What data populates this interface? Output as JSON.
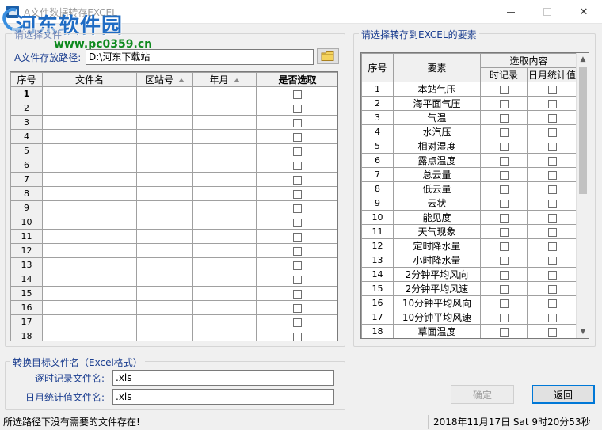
{
  "window": {
    "title": "A文件数据转存EXCEL"
  },
  "watermark": {
    "text": "河东软件园",
    "url": "www.pc0359.cn"
  },
  "select_file_group": {
    "legend": "请选择文件",
    "path_label": "A文件存放路径:",
    "path_value": "D:\\河东下载站",
    "columns": [
      "序号",
      "文件名",
      "区站号",
      "年月",
      "是否选取"
    ],
    "rows": [
      "1",
      "2",
      "3",
      "4",
      "5",
      "6",
      "7",
      "8",
      "9",
      "10",
      "11",
      "12",
      "13",
      "14",
      "15",
      "16",
      "17",
      "18"
    ]
  },
  "elements_group": {
    "legend": "请选择转存到EXCEL的要素",
    "header_no": "序号",
    "header_element": "要素",
    "header_select": "选取内容",
    "header_record": "时记录",
    "header_daily": "日月统计值",
    "rows": [
      {
        "no": "1",
        "name": "本站气压"
      },
      {
        "no": "2",
        "name": "海平面气压"
      },
      {
        "no": "3",
        "name": "气温"
      },
      {
        "no": "4",
        "name": "水汽压"
      },
      {
        "no": "5",
        "name": "相对湿度"
      },
      {
        "no": "6",
        "name": "露点温度"
      },
      {
        "no": "7",
        "name": "总云量"
      },
      {
        "no": "8",
        "name": "低云量"
      },
      {
        "no": "9",
        "name": "云状"
      },
      {
        "no": "10",
        "name": "能见度"
      },
      {
        "no": "11",
        "name": "天气现象"
      },
      {
        "no": "12",
        "name": "定时降水量"
      },
      {
        "no": "13",
        "name": "小时降水量"
      },
      {
        "no": "14",
        "name": "2分钟平均风向"
      },
      {
        "no": "15",
        "name": "2分钟平均风速"
      },
      {
        "no": "16",
        "name": "10分钟平均风向"
      },
      {
        "no": "17",
        "name": "10分钟平均风速"
      },
      {
        "no": "18",
        "name": "草面温度"
      }
    ]
  },
  "target_group": {
    "legend": "转换目标文件名（Excel格式）",
    "record_label": "逐时记录文件名:",
    "record_value": ".xls",
    "daily_label": "日月统计值文件名:",
    "daily_value": ".xls"
  },
  "buttons": {
    "confirm": "确定",
    "back": "返回"
  },
  "status": {
    "message": "所选路径下没有需要的文件存在!",
    "datetime": "2018年11月17日  Sat 9时20分53秒"
  },
  "colors": {
    "label_blue": "#1a3d8f",
    "watermark_blue": "#1f6cc4",
    "watermark_green": "#0f8a1f"
  }
}
